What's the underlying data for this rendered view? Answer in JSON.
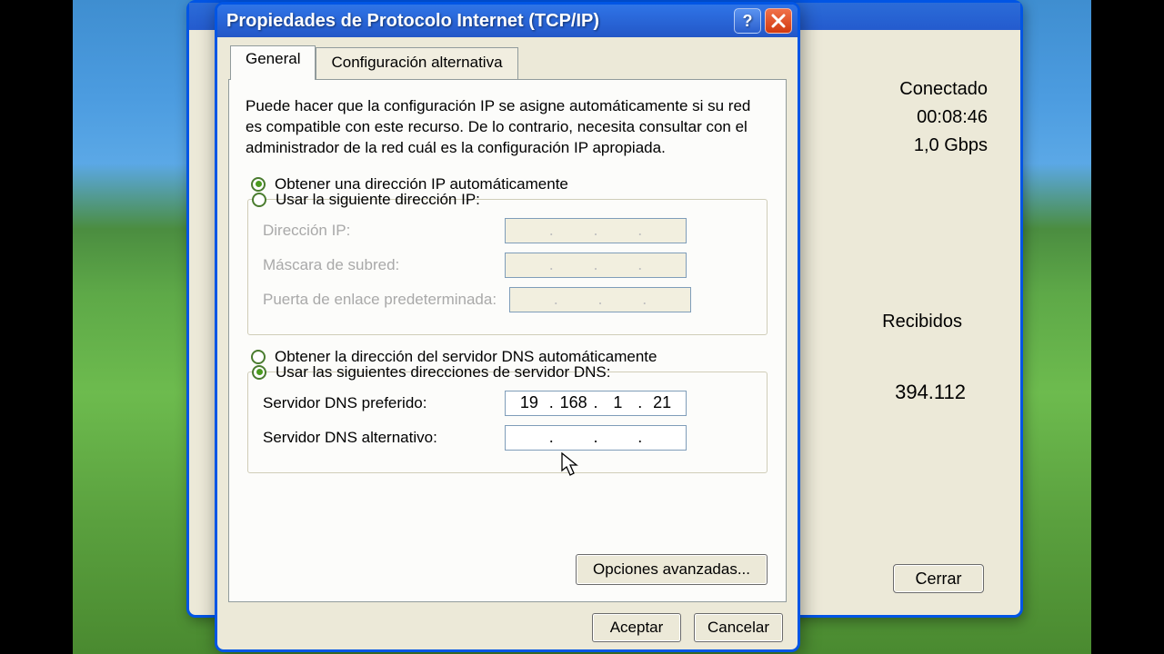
{
  "dialog": {
    "title": "Propiedades de Protocolo Internet (TCP/IP)",
    "tabs": {
      "general": "General",
      "alt": "Configuración alternativa"
    },
    "description": "Puede hacer que la configuración IP se asigne automáticamente si su red es compatible con este recurso. De lo contrario, necesita consultar con el administrador de la red cuál es la configuración IP apropiada.",
    "ip_auto": "Obtener una dirección IP automáticamente",
    "ip_manual": "Usar la siguiente dirección IP:",
    "labels": {
      "ip": "Dirección IP:",
      "mask": "Máscara de subred:",
      "gw": "Puerta de enlace predeterminada:"
    },
    "dns_auto": "Obtener la dirección del servidor DNS automáticamente",
    "dns_manual": "Usar las siguientes direcciones de servidor DNS:",
    "dns_labels": {
      "pref": "Servidor DNS preferido:",
      "alt": "Servidor DNS alternativo:"
    },
    "dns_pref": {
      "a": "19",
      "b": "168",
      "c": "1",
      "d": "21"
    },
    "dns_alt": {
      "a": "",
      "b": "",
      "c": "",
      "d": ""
    },
    "advanced": "Opciones avanzadas...",
    "ok": "Aceptar",
    "cancel": "Cancelar"
  },
  "back": {
    "status": "Conectado",
    "duration": "00:08:46",
    "speed": "1,0 Gbps",
    "recv_label": "Recibidos",
    "recv_val": "394.112",
    "close": "Cerrar"
  }
}
